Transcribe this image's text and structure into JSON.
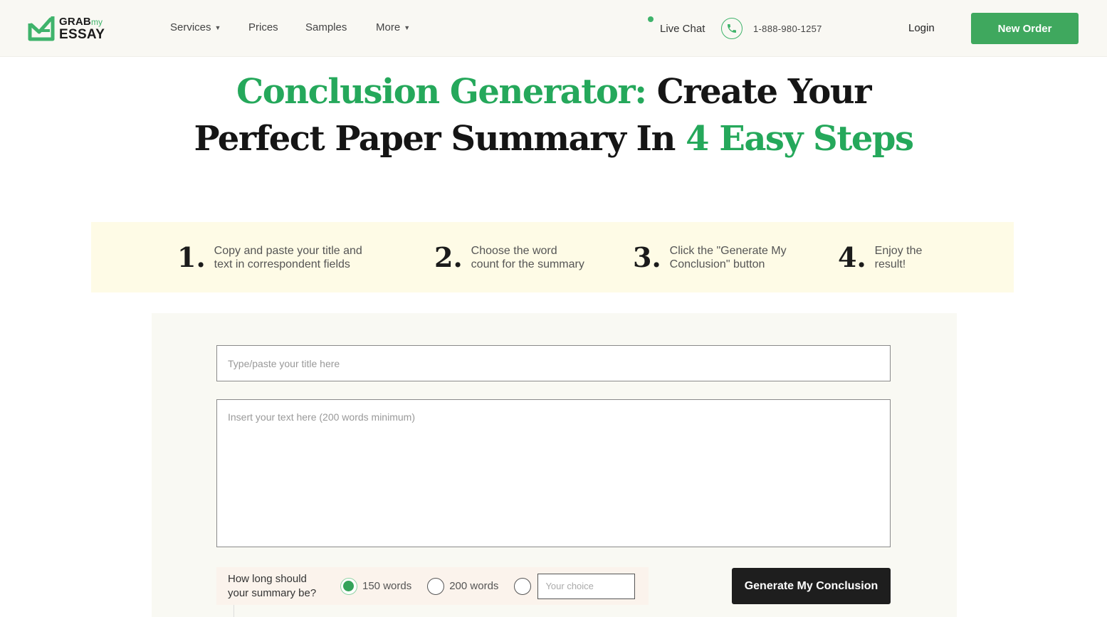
{
  "header": {
    "logo": {
      "line1": "GRAB",
      "line1_suffix": "my",
      "line2": "ESSAY"
    },
    "nav": [
      {
        "label": "Services",
        "has_dropdown": true
      },
      {
        "label": "Prices",
        "has_dropdown": false
      },
      {
        "label": "Samples",
        "has_dropdown": false
      },
      {
        "label": "More",
        "has_dropdown": true
      }
    ],
    "chevron": "⌄",
    "live_chat": "Live Chat",
    "phone": "1-888-980-1257",
    "login": "Login",
    "new_order": "New Order"
  },
  "hero": {
    "line1_green": "Conclusion Generator:",
    "line1_dark": " Create Your",
    "line2_dark": "Perfect Paper Summary In ",
    "line2_green": "4 Easy Steps"
  },
  "steps": [
    {
      "num": "1.",
      "line1": "Copy and paste your title and",
      "line2": "text in correspondent fields"
    },
    {
      "num": "2.",
      "line1": "Choose the word",
      "line2": "count for the summary"
    },
    {
      "num": "3.",
      "line1": "Click the \"Generate My",
      "line2": "Conclusion\" button"
    },
    {
      "num": "4.",
      "line1": "Enjoy the",
      "line2": "result!"
    }
  ],
  "form": {
    "title_placeholder": "Type/paste your title here",
    "title_value": "",
    "text_placeholder": "Insert your text here (200 words minimum)",
    "text_value": "",
    "length_question_line1": "How long should",
    "length_question_line2": "your summary be?",
    "options": [
      {
        "label": "150 words",
        "checked": true
      },
      {
        "label": "200 words",
        "checked": false
      },
      {
        "label": "",
        "checked": false
      }
    ],
    "choice_placeholder": "Your choice",
    "choice_value": "",
    "generate_button": "Generate My Conclusion"
  },
  "colors": {
    "brand_green": "#25a85b",
    "button_green": "#3fa85e",
    "dark_button": "#1e1e1e",
    "steps_bg": "#fefbe6",
    "header_bg": "#f9f8f3"
  }
}
